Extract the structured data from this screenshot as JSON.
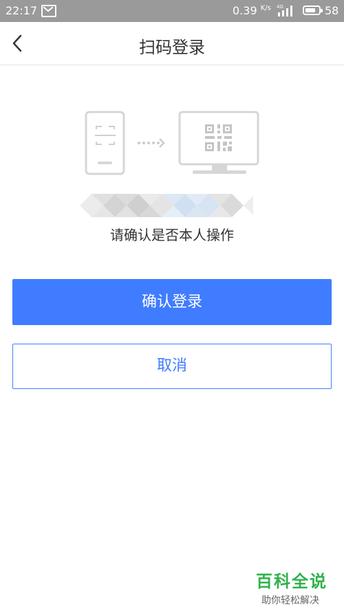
{
  "status_bar": {
    "time": "22:17",
    "network_speed": "0.39",
    "network_speed_unit": "K/s",
    "signal_label": "4G",
    "battery_level": "58",
    "icons": [
      "message-icon",
      "signal-icon",
      "battery-icon"
    ]
  },
  "header": {
    "title": "扫码登录",
    "back_icon": "chevron-left-icon"
  },
  "illustration": {
    "icons": [
      "phone-scanner-icon",
      "dotted-arrow-icon",
      "monitor-qr-icon"
    ]
  },
  "main": {
    "confirm_hint": "请确认是否本人操作"
  },
  "buttons": {
    "confirm_label": "确认登录",
    "cancel_label": "取消"
  },
  "watermark": {
    "main": "百科全说",
    "sub": "助你轻松解决"
  },
  "colors": {
    "accent": "#3f7cff",
    "status_bar_bg": "#9a9a9a",
    "watermark_green": "#2eb24a"
  }
}
